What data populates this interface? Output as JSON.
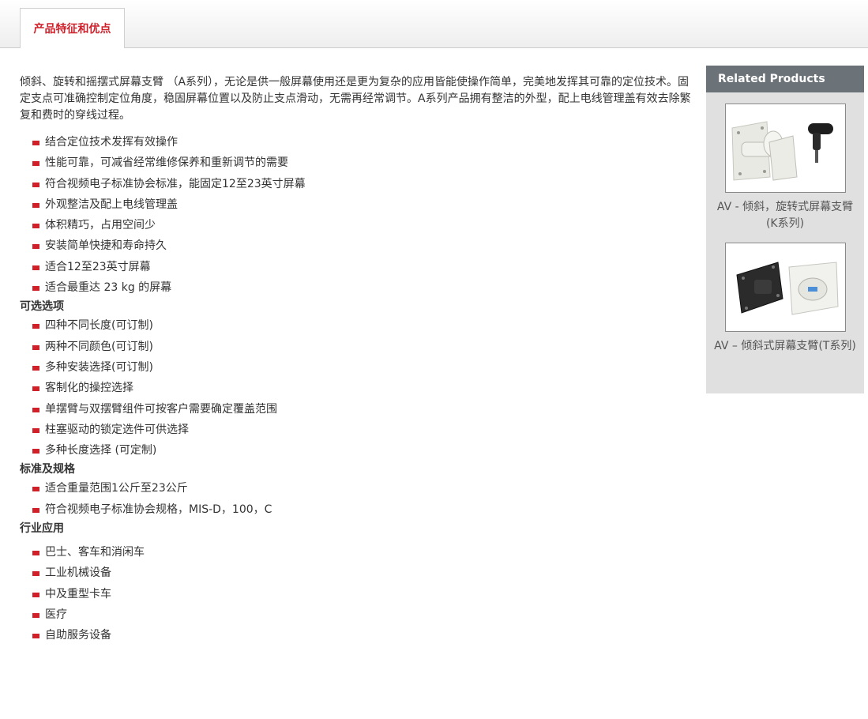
{
  "tabs": [
    {
      "label": "产品特征和优点"
    }
  ],
  "intro": "倾斜、旋转和摇摆式屏幕支臂 （A系列），无论是供一般屏幕使用还是更为复杂的应用皆能使操作简单，完美地发挥其可靠的定位技术。固定支点可准确控制定位角度，稳固屏幕位置以及防止支点滑动，无需再经常调节。A系列产品拥有整洁的外型，配上电线管理盖有效去除繁复和费时的穿线过程。",
  "features": [
    "结合定位技术发挥有效操作",
    "性能可靠，可减省经常维修保养和重新调节的需要",
    "符合视频电子标准协会标准，能固定12至23英寸屏幕",
    "外观整洁及配上电线管理盖",
    "体积精巧，占用空间少",
    "安装简单快捷和寿命持久",
    "适合12至23英寸屏幕",
    "适合最重达 23 kg 的屏幕"
  ],
  "options": {
    "title": "可选选项",
    "items": [
      "四种不同长度(可订制)",
      "两种不同颜色(可订制)",
      "多种安装选择(可订制)",
      "客制化的操控选择",
      "单摆臂与双摆臂组件可按客户需要确定覆盖范围",
      "柱塞驱动的锁定选件可供选择",
      "多种长度选择 (可定制)"
    ]
  },
  "specs": {
    "title": "标准及规格",
    "items": [
      "适合重量范围1公斤至23公斤",
      "符合视频电子标准协会规格，MIS-D，100，C"
    ]
  },
  "apps": {
    "title": "行业应用",
    "items": [
      "巴士、客车和消闲车",
      "工业机械设备",
      "中及重型卡车",
      "医疗",
      "自助服务设备"
    ]
  },
  "sidebar": {
    "title": "Related Products",
    "products": [
      {
        "name": "AV - 倾斜，旋转式屏幕支臂(K系列)"
      },
      {
        "name": "AV – 倾斜式屏幕支臂(T系列)"
      }
    ]
  },
  "colors": {
    "accent": "#d0202a",
    "sidebar_head": "#6b7278",
    "sidebar_bg": "#e0e0e0"
  }
}
